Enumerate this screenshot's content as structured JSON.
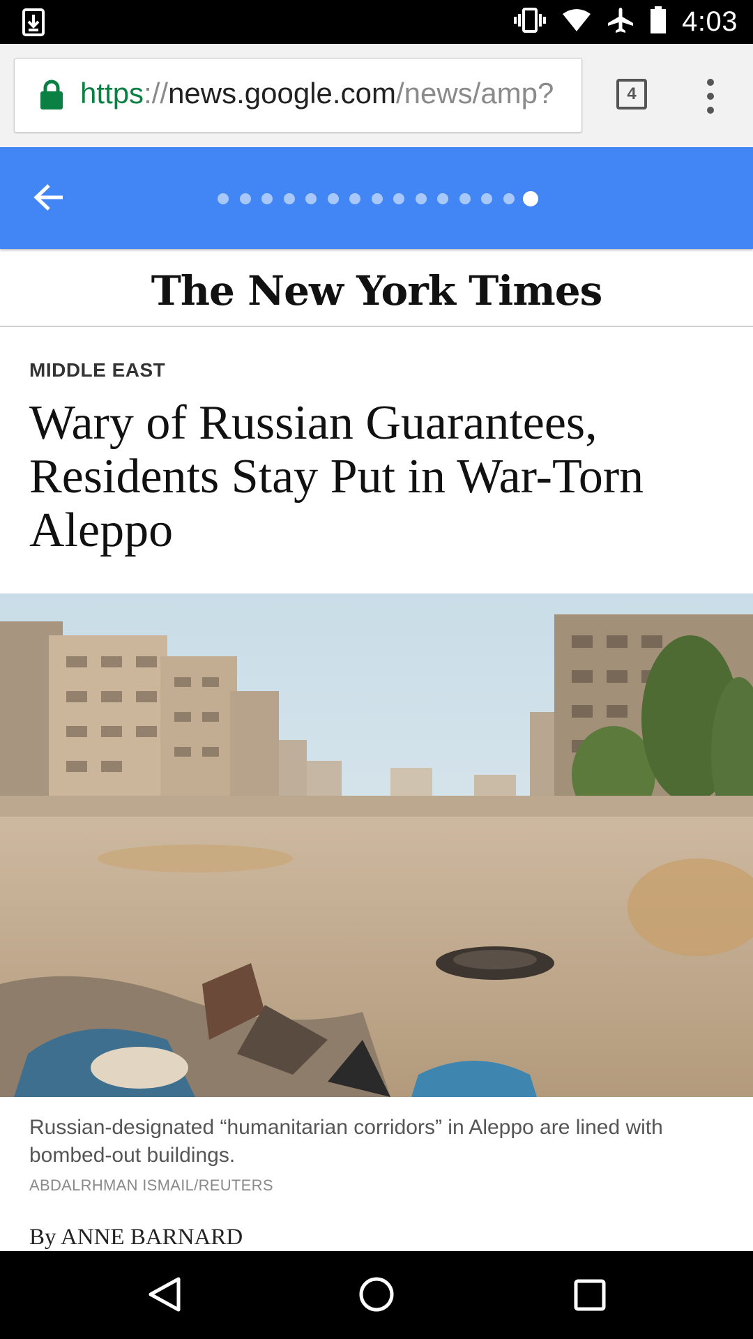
{
  "status_bar": {
    "time": "4:03"
  },
  "browser": {
    "url_scheme": "https",
    "url_separator": "://",
    "url_host": "news.google.com",
    "url_path": "/news/amp?",
    "tab_count": "4"
  },
  "carousel": {
    "dot_count": 15,
    "active_index": 14
  },
  "publication": {
    "masthead": "The New York Times"
  },
  "article": {
    "section": "MIDDLE EAST",
    "headline": "Wary of Russian Guarantees, Residents Stay Put in War-Torn Aleppo",
    "image_caption": "Russian-designated “humanitarian corridors” in Aleppo are lined with bombed-out buildings.",
    "image_credit": "ABDALRHMAN ISMAIL/REUTERS",
    "byline": "By ANNE BARNARD"
  },
  "colors": {
    "accent_blue": "#4285f4",
    "secure_green": "#0b8043"
  },
  "icons": [
    "download-icon",
    "vibrate-icon",
    "wifi-icon",
    "airplane-mode-icon",
    "battery-icon",
    "lock-icon",
    "tab-switcher-icon",
    "overflow-menu-icon",
    "back-arrow-icon",
    "nav-back-icon",
    "nav-home-icon",
    "nav-recents-icon"
  ]
}
